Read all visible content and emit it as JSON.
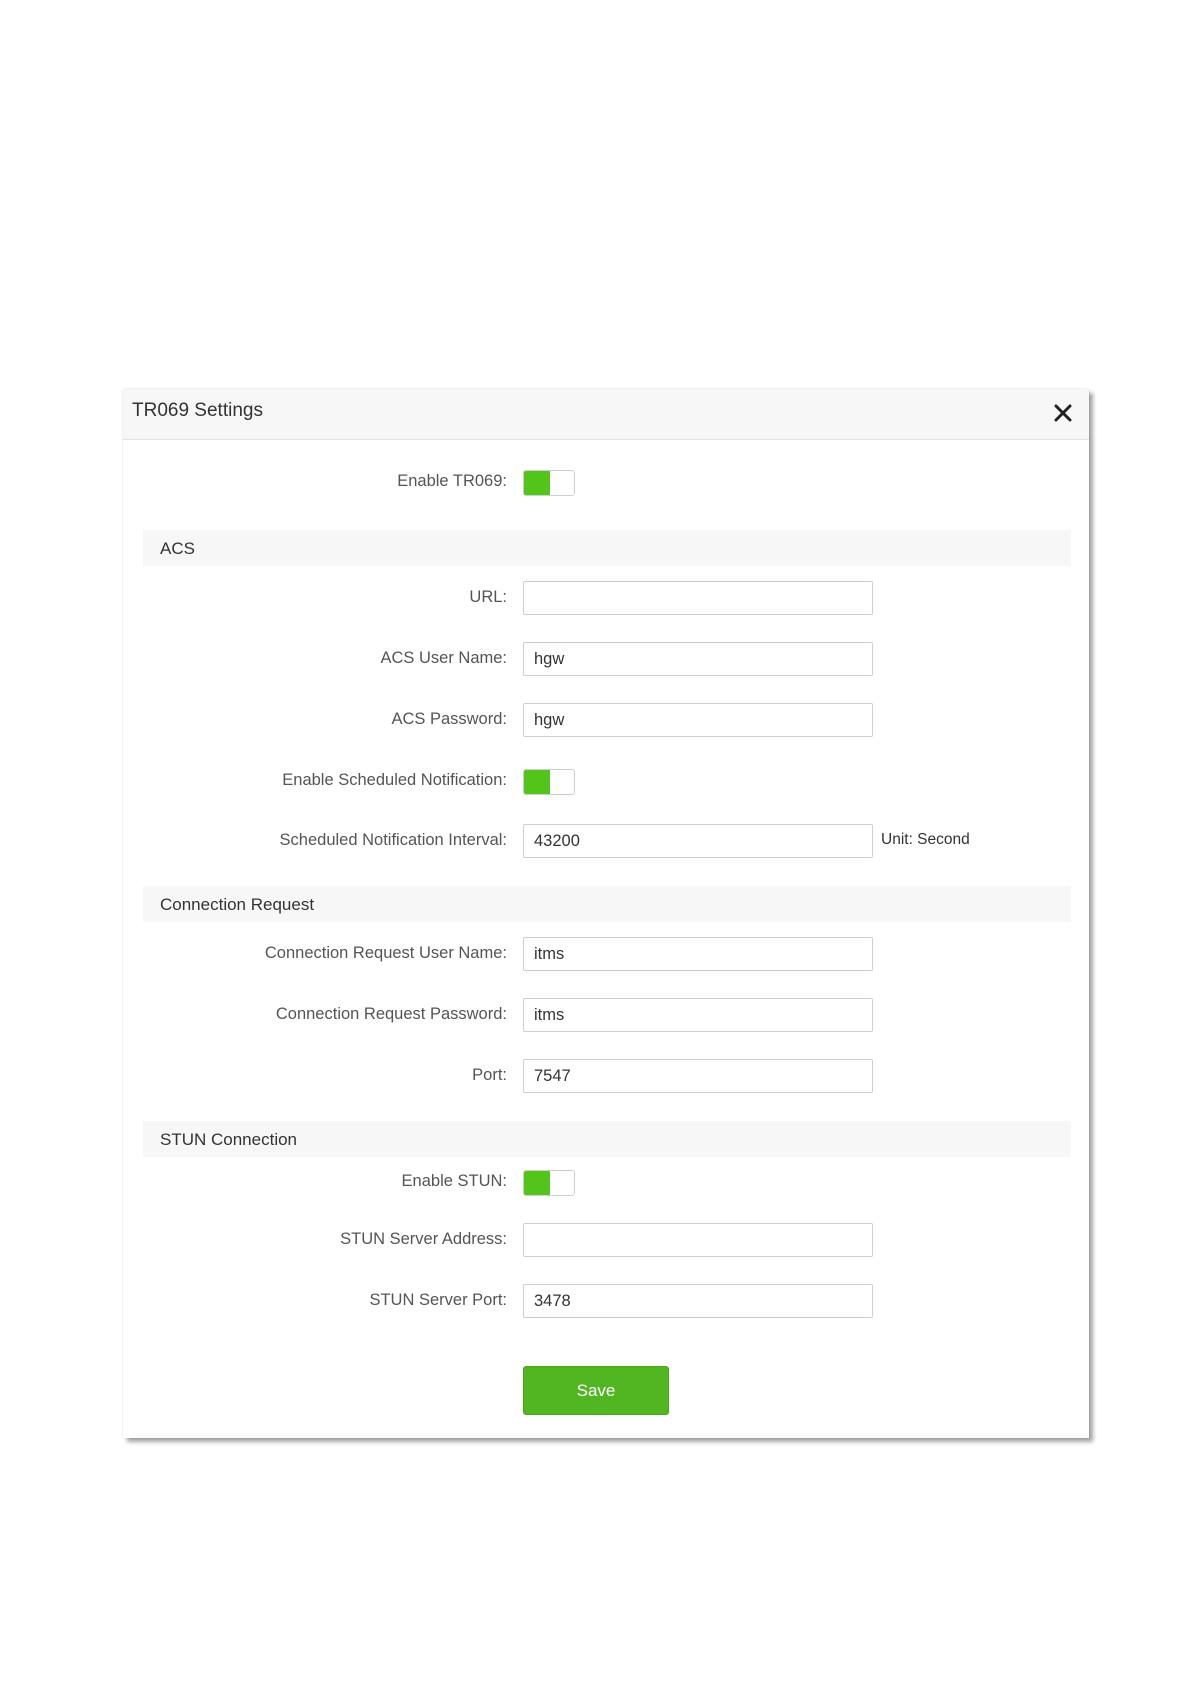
{
  "dialog": {
    "title": "TR069 Settings",
    "close_icon": "close-icon",
    "enable_tr069": {
      "label": "Enable TR069:",
      "on": true
    },
    "sections": {
      "acs": "ACS",
      "connection_request": "Connection Request",
      "stun": "STUN Connection"
    },
    "acs": {
      "url": {
        "label": "URL:",
        "value": ""
      },
      "user_name": {
        "label": "ACS User Name:",
        "value": "hgw"
      },
      "password": {
        "label": "ACS Password:",
        "value": "hgw"
      },
      "enable_notification": {
        "label": "Enable Scheduled Notification:",
        "on": true
      },
      "interval": {
        "label": "Scheduled Notification Interval:",
        "value": "43200",
        "unit": "Unit: Second"
      }
    },
    "connection_request": {
      "user_name": {
        "label": "Connection Request User Name:",
        "value": "itms"
      },
      "password": {
        "label": "Connection Request Password:",
        "value": "itms"
      },
      "port": {
        "label": "Port:",
        "value": "7547"
      }
    },
    "stun": {
      "enable": {
        "label": "Enable STUN:",
        "on": true
      },
      "server_address": {
        "label": "STUN Server Address:",
        "value": ""
      },
      "server_port": {
        "label": "STUN Server Port:",
        "value": "3478"
      }
    },
    "save_label": "Save",
    "accent_color": "#52c41a"
  }
}
